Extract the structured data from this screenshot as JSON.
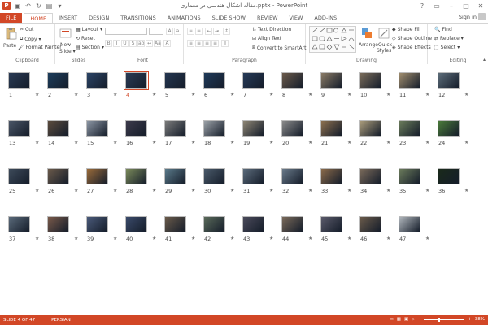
{
  "title": "مقاله اشکال هندسی در معماری.pptx - PowerPoint",
  "window_controls": {
    "help": "?",
    "ribbon_options": "▭",
    "minimize": "–",
    "maximize": "□",
    "close": "✕"
  },
  "tabs": [
    "FILE",
    "HOME",
    "INSERT",
    "DESIGN",
    "TRANSITIONS",
    "ANIMATIONS",
    "SLIDE SHOW",
    "REVIEW",
    "VIEW",
    "ADD-INS"
  ],
  "active_tab": "HOME",
  "signin": "Sign in",
  "ribbon": {
    "clipboard": {
      "label": "Clipboard",
      "paste": "Paste",
      "cut": "Cut",
      "copy": "Copy",
      "format_painter": "Format Painter"
    },
    "slides": {
      "label": "Slides",
      "new_slide": "New",
      "new_slide_2": "Slide",
      "layout": "Layout",
      "reset": "Reset",
      "section": "Section"
    },
    "font": {
      "label": "Font"
    },
    "paragraph": {
      "label": "Paragraph",
      "text_direction": "Text Direction",
      "align_text": "Align Text",
      "convert_smartart": "Convert to SmartArt"
    },
    "drawing": {
      "label": "Drawing",
      "arrange": "Arrange",
      "quick_styles": "Quick",
      "quick_styles_2": "Styles",
      "shape_fill": "Shape Fill",
      "shape_outline": "Shape Outline",
      "shape_effects": "Shape Effects"
    },
    "editing": {
      "label": "Editing",
      "find": "Find",
      "replace": "Replace",
      "select": "Select"
    }
  },
  "slides": [
    {
      "n": "1",
      "c": "#2a3b55"
    },
    {
      "n": "2",
      "c": "#1d3d5c"
    },
    {
      "n": "3",
      "c": "#2b4466"
    },
    {
      "n": "4",
      "c": "#2a3b55"
    },
    {
      "n": "5",
      "c": "#243650"
    },
    {
      "n": "6",
      "c": "#1f3a5a"
    },
    {
      "n": "7",
      "c": "#263a58"
    },
    {
      "n": "8",
      "c": "#6b5a4a"
    },
    {
      "n": "9",
      "c": "#8a7b66"
    },
    {
      "n": "10",
      "c": "#7a6c5a"
    },
    {
      "n": "11",
      "c": "#a08d6e"
    },
    {
      "n": "12",
      "c": "#5d6d7a"
    },
    {
      "n": "13",
      "c": "#4a5566"
    },
    {
      "n": "14",
      "c": "#5b4b3d"
    },
    {
      "n": "15",
      "c": "#8b95a3"
    },
    {
      "n": "16",
      "c": "#3c3a4a"
    },
    {
      "n": "17",
      "c": "#7a7a7a"
    },
    {
      "n": "18",
      "c": "#9aa0a6"
    },
    {
      "n": "19",
      "c": "#8c8473"
    },
    {
      "n": "20",
      "c": "#8a8a8a"
    },
    {
      "n": "21",
      "c": "#8b6f4f"
    },
    {
      "n": "22",
      "c": "#a89a7a"
    },
    {
      "n": "23",
      "c": "#6a7b5a"
    },
    {
      "n": "24",
      "c": "#4a7a3a"
    },
    {
      "n": "25",
      "c": "#3d4a5a"
    },
    {
      "n": "26",
      "c": "#6b5a4a"
    },
    {
      "n": "27",
      "c": "#9a6b3a"
    },
    {
      "n": "28",
      "c": "#7a8a5a"
    },
    {
      "n": "29",
      "c": "#5a7a8a"
    },
    {
      "n": "30",
      "c": "#4a5a6a"
    },
    {
      "n": "31",
      "c": "#5b6b7b"
    },
    {
      "n": "32",
      "c": "#6a7a8a"
    },
    {
      "n": "33",
      "c": "#8a6a4a"
    },
    {
      "n": "34",
      "c": "#7a6a5a"
    },
    {
      "n": "35",
      "c": "#6b7b5b"
    },
    {
      "n": "36",
      "c": "#1a2a1a"
    },
    {
      "n": "37",
      "c": "#5a6a7a"
    },
    {
      "n": "38",
      "c": "#7a5a4a"
    },
    {
      "n": "39",
      "c": "#4a5a7a"
    },
    {
      "n": "40",
      "c": "#3a4a6a"
    },
    {
      "n": "41",
      "c": "#6a5a4a"
    },
    {
      "n": "42",
      "c": "#5a6a5a"
    },
    {
      "n": "43",
      "c": "#4a4a5a"
    },
    {
      "n": "44",
      "c": "#7a6a5a"
    },
    {
      "n": "45",
      "c": "#5a5a6a"
    },
    {
      "n": "46",
      "c": "#6a5a4a"
    },
    {
      "n": "47",
      "c": "#b0b6bc"
    }
  ],
  "selected_slide": "4",
  "star": "★",
  "status": {
    "slide_info": "SLIDE 4 OF 47",
    "language": "PERSIAN",
    "zoom": "38%",
    "zoom_level": 0.38
  }
}
